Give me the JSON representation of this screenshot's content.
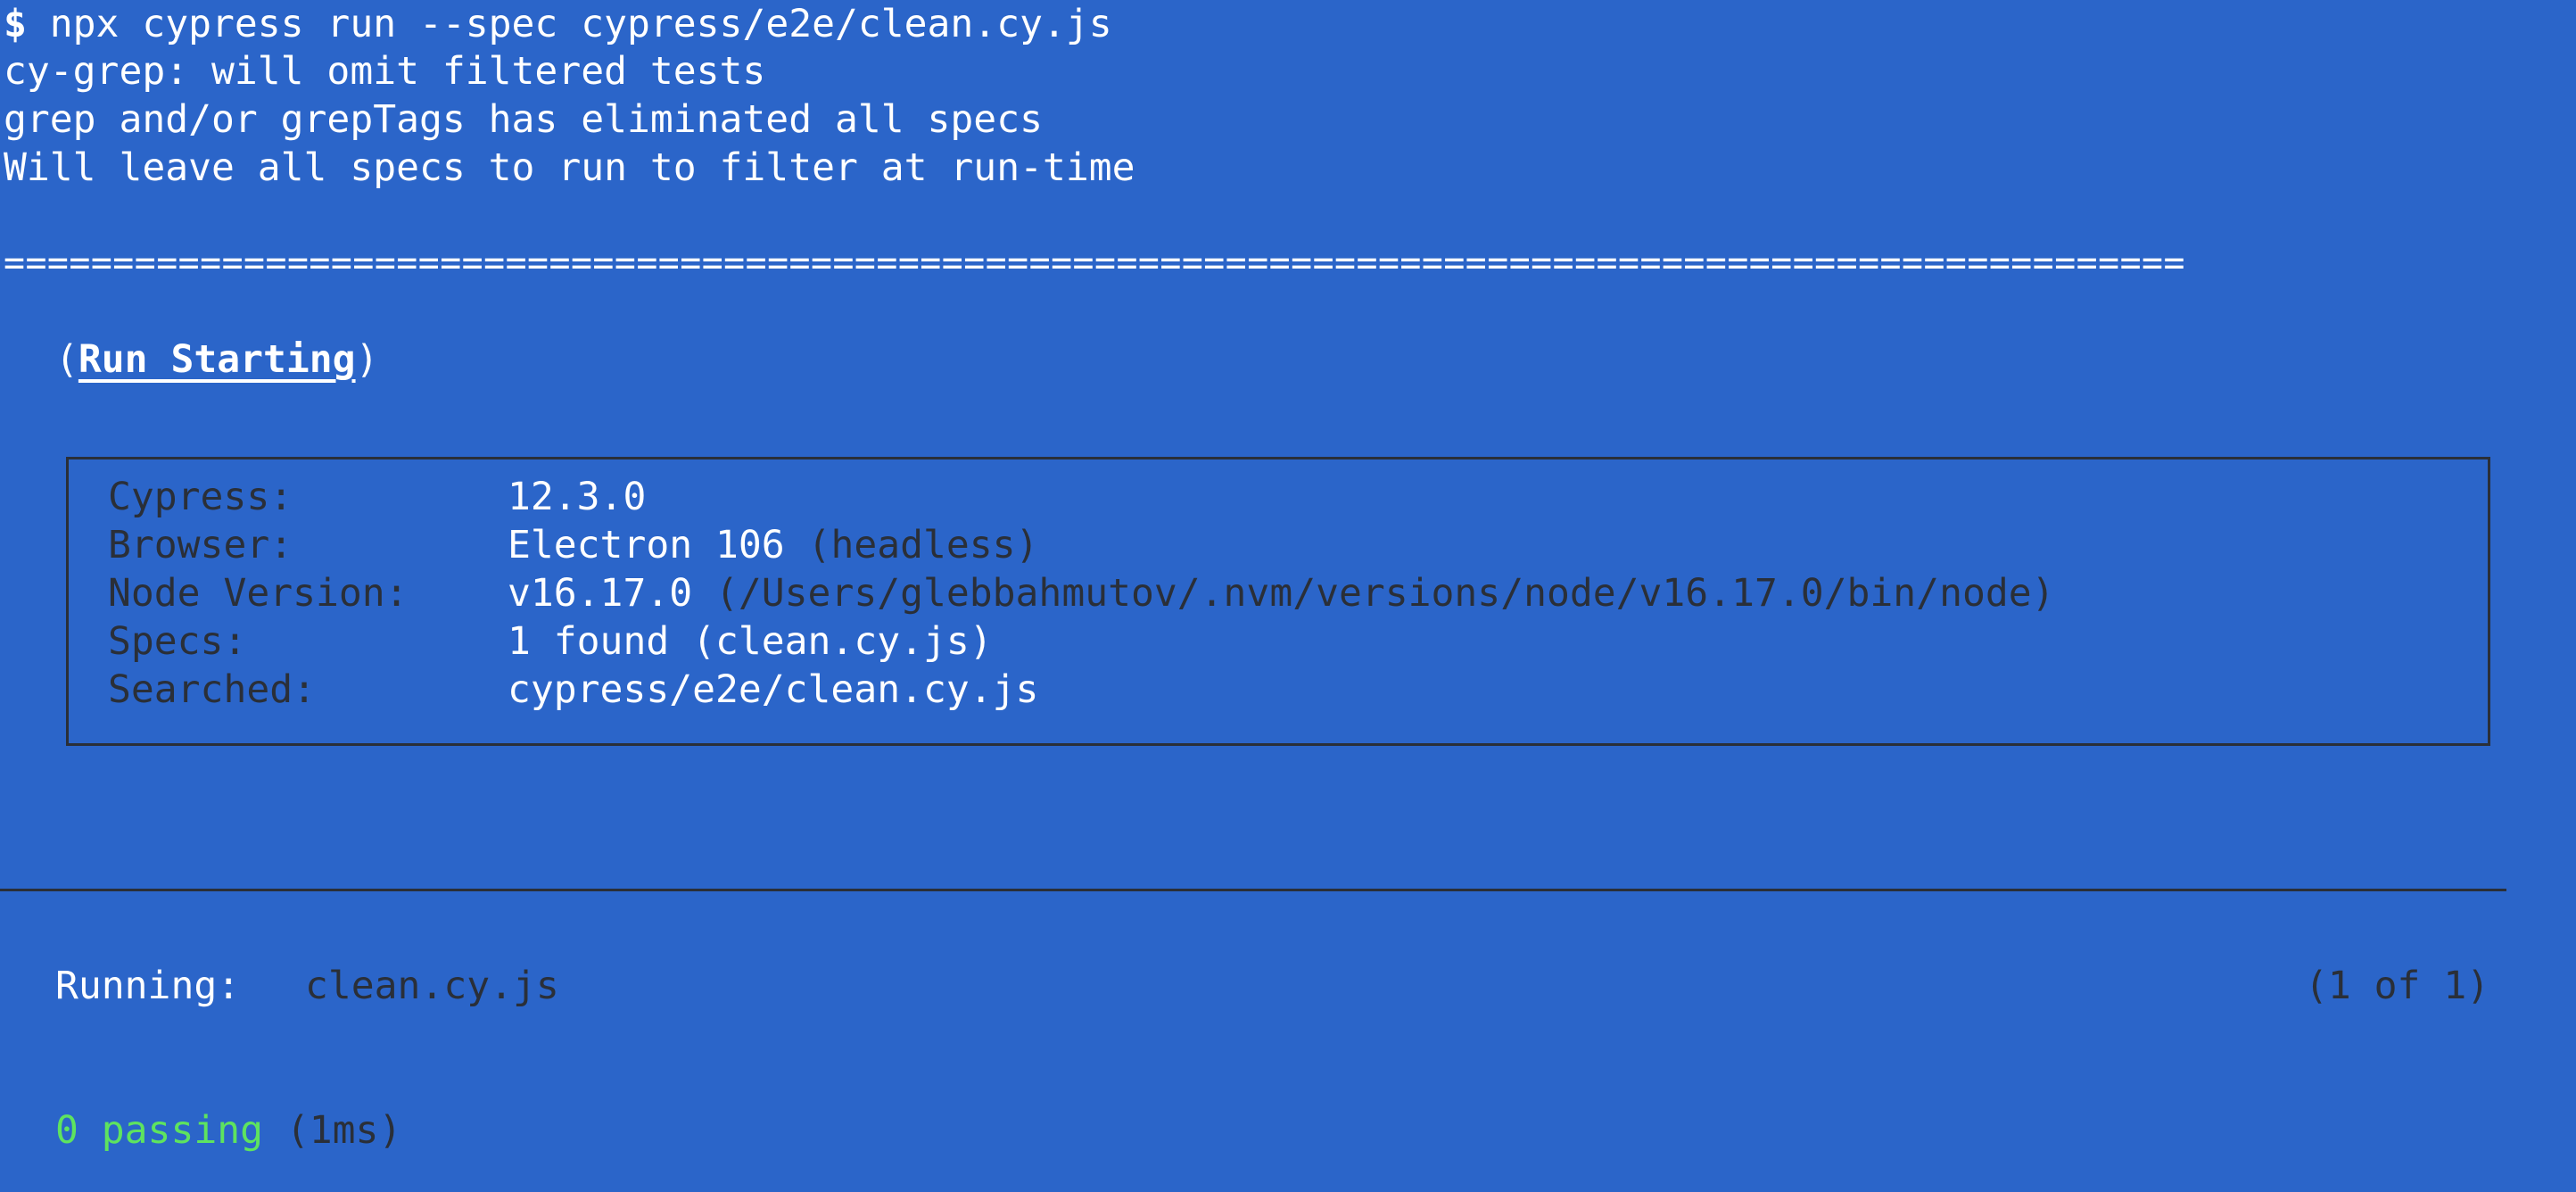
{
  "terminal": {
    "prompt": "$",
    "command": " npx cypress run --spec cypress/e2e/clean.cy.js",
    "output_lines": [
      "cy-grep: will omit filtered tests",
      "grep and/or grepTags has eliminated all specs",
      "Will leave all specs to run to filter at run-time"
    ],
    "separator": "====================================================================================================",
    "run_starting": {
      "open_paren": "(",
      "label": "Run Starting",
      "close_paren": ")"
    },
    "info": {
      "cypress_label": "Cypress:",
      "cypress_value": "12.3.0",
      "browser_label": "Browser:",
      "browser_value": "Electron 106",
      "browser_note": " (headless)",
      "node_label": "Node Version:",
      "node_value": "v16.17.0",
      "node_path": " (/Users/glebbahmutov/.nvm/versions/node/v16.17.0/bin/node)",
      "specs_label": "Specs:",
      "specs_value": "1 found (clean.cy.js)",
      "searched_label": "Searched:",
      "searched_value": "cypress/e2e/clean.cy.js"
    },
    "running": {
      "label": "Running:",
      "spec": "clean.cy.js",
      "count": "(1 of 1)"
    },
    "result": {
      "passing": "0 passing",
      "duration": " (1ms)"
    }
  },
  "colors": {
    "background": "#2b65c9",
    "text": "#ffffff",
    "dim": "#2a2f38",
    "passing": "#5ee35f"
  }
}
